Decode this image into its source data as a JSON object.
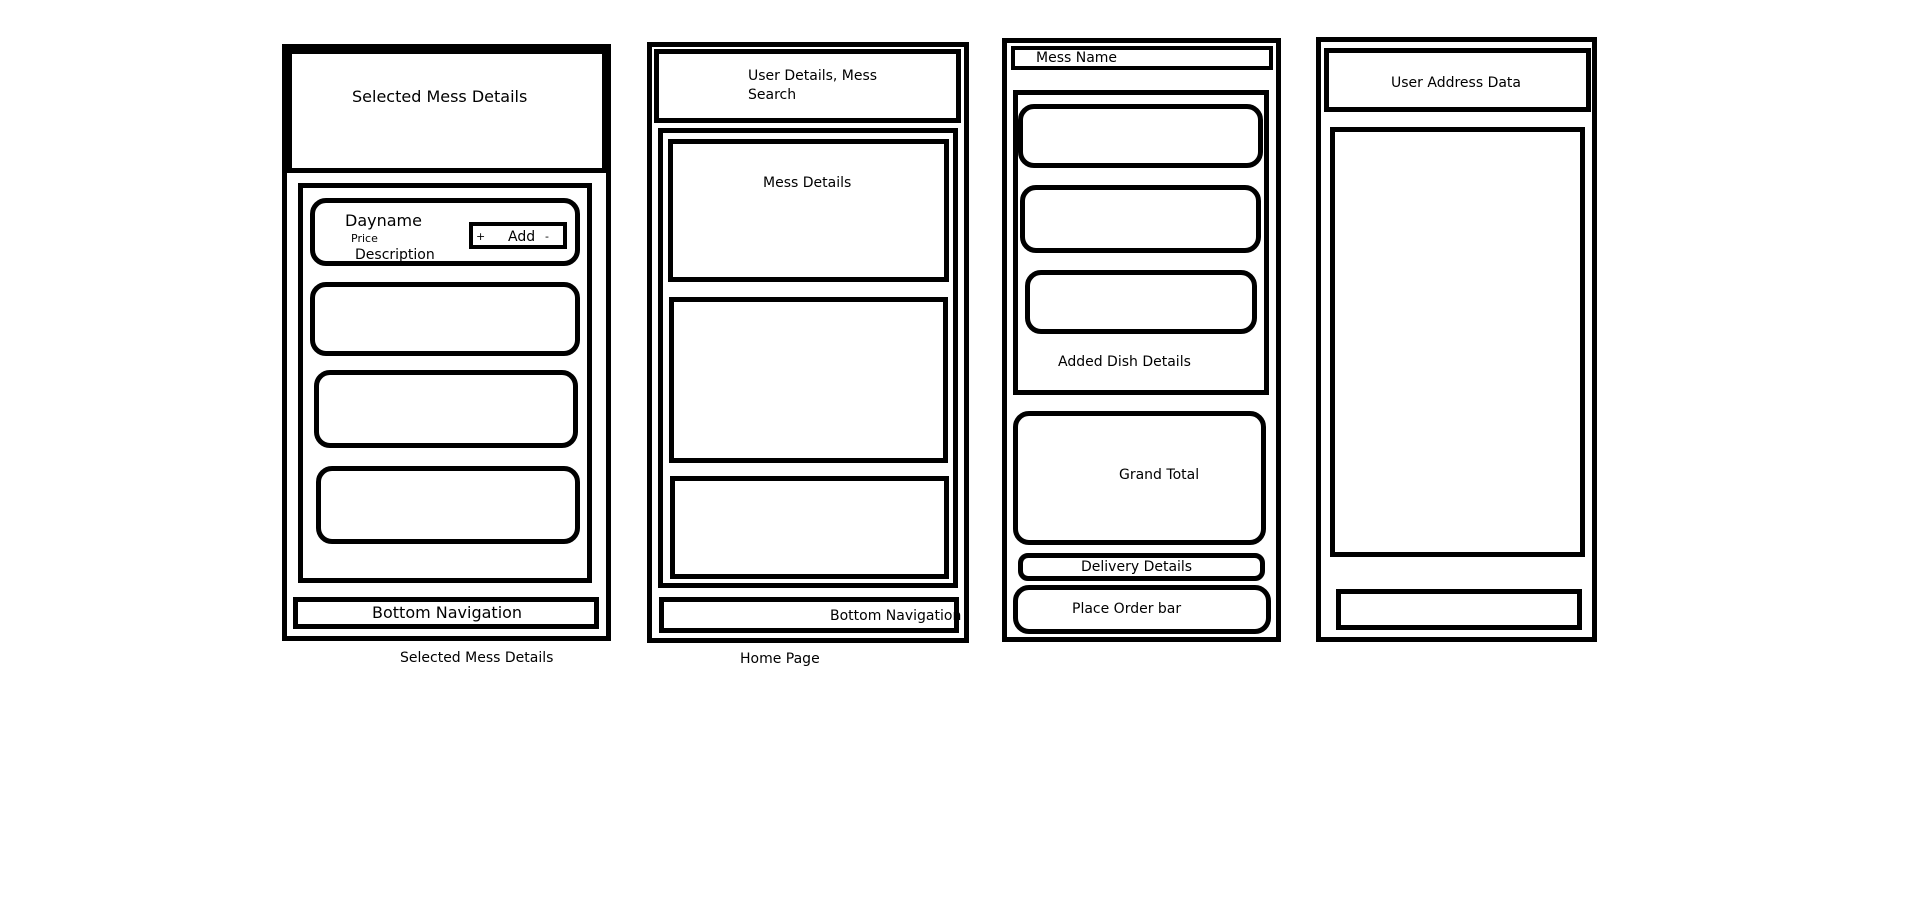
{
  "screen_selected_mess": {
    "header_text": "Selected Mess Details",
    "item_card": {
      "dayname": "Dayname",
      "price": "Price",
      "description": "Description",
      "plus": "+",
      "add": "Add",
      "minus": "-"
    },
    "bottom_nav": "Bottom Navigation",
    "caption": "Selected Mess Details"
  },
  "screen_home": {
    "header_line1": "User Details, Mess",
    "header_line2": "Search",
    "mess_card_title": "Mess Details",
    "bottom_nav": "Bottom Navigation",
    "caption": "Home Page"
  },
  "screen_cart": {
    "mess_name": "Mess Name",
    "added_dish_label": "Added Dish Details",
    "grand_total": "Grand Total",
    "delivery_details": "Delivery Details",
    "place_order": "Place Order bar"
  },
  "screen_address": {
    "header_text": "User Address Data"
  }
}
